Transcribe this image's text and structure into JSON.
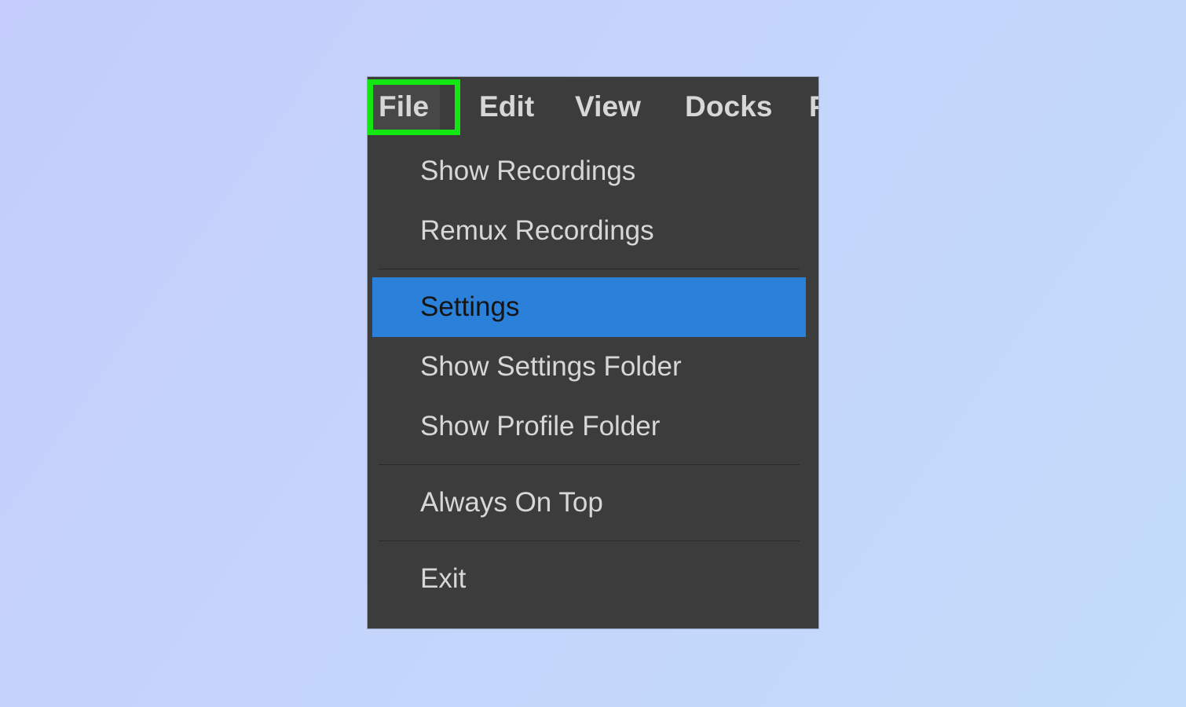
{
  "desktop": {
    "background_top_color": "#c4cdfb",
    "background_bottom_color": "#c3dcfb"
  },
  "app_window": {
    "panel_color": "#3c3c3c",
    "menubar": {
      "items": [
        {
          "label": "File",
          "active": true,
          "truncated": false
        },
        {
          "label": "Edit",
          "active": false,
          "truncated": false
        },
        {
          "label": "View",
          "active": false,
          "truncated": false
        },
        {
          "label": "Docks",
          "active": false,
          "truncated": false
        },
        {
          "label": "P",
          "active": false,
          "truncated": true
        }
      ],
      "highlight": {
        "target": "File",
        "color": "#12e712",
        "style": "rectangle-outline"
      }
    },
    "file_menu": {
      "selected_item": "Settings",
      "selection_color": "#2b80da",
      "selection_text_color": "#151515",
      "text_color": "#d7d7d7",
      "separator_color": "#2a2a2a",
      "entries": [
        {
          "type": "item",
          "label": "Show Recordings",
          "selected": false
        },
        {
          "type": "item",
          "label": "Remux Recordings",
          "selected": false
        },
        {
          "type": "separator",
          "label": ""
        },
        {
          "type": "item",
          "label": "Settings",
          "selected": true
        },
        {
          "type": "item",
          "label": "Show Settings Folder",
          "selected": false
        },
        {
          "type": "item",
          "label": "Show Profile Folder",
          "selected": false
        },
        {
          "type": "separator",
          "label": ""
        },
        {
          "type": "item",
          "label": "Always On Top",
          "selected": false
        },
        {
          "type": "separator",
          "label": ""
        },
        {
          "type": "item",
          "label": "Exit",
          "selected": false
        }
      ]
    }
  }
}
